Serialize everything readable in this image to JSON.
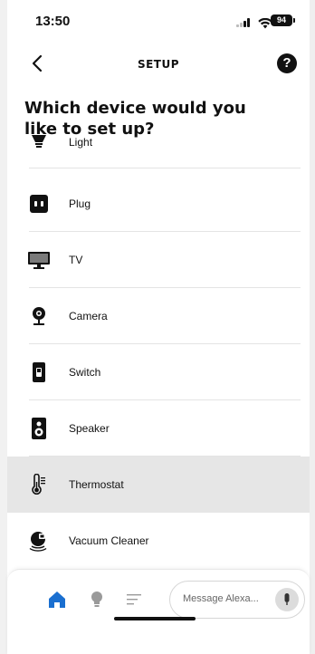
{
  "status_bar": {
    "time": "13:50",
    "battery": "94"
  },
  "header": {
    "title": "SETUP",
    "help": "?"
  },
  "page": {
    "title": "Which device would you like to set up?"
  },
  "devices": [
    {
      "label": "Light",
      "icon": "light-bulb-icon",
      "selected": false
    },
    {
      "label": "Plug",
      "icon": "plug-icon",
      "selected": false
    },
    {
      "label": "TV",
      "icon": "tv-icon",
      "selected": false
    },
    {
      "label": "Camera",
      "icon": "camera-icon",
      "selected": false
    },
    {
      "label": "Switch",
      "icon": "switch-icon",
      "selected": false
    },
    {
      "label": "Speaker",
      "icon": "speaker-icon",
      "selected": false
    },
    {
      "label": "Thermostat",
      "icon": "thermostat-icon",
      "selected": true
    },
    {
      "label": "Vacuum Cleaner",
      "icon": "vacuum-icon",
      "selected": false
    }
  ],
  "bottom_nav": {
    "items": [
      {
        "name": "home",
        "icon": "home-icon",
        "active": true
      },
      {
        "name": "devices",
        "icon": "bulb-icon",
        "active": false
      },
      {
        "name": "more",
        "icon": "menu-lines-icon",
        "active": false
      }
    ],
    "message_placeholder": "Message Alexa..."
  },
  "colors": {
    "accent": "#1a6fd0",
    "selected_row": "#e6e6e6",
    "icon_dark": "#111111",
    "nav_inactive": "#9a9a9a"
  }
}
